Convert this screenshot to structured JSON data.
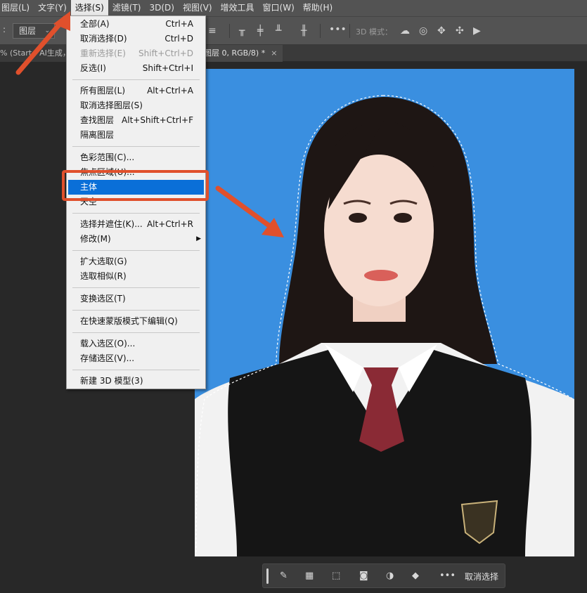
{
  "menubar": {
    "items": [
      "图层(L)",
      "文字(Y)",
      "选择(S)",
      "滤镜(T)",
      "3D(D)",
      "视图(V)",
      "增效工具",
      "窗口(W)",
      "帮助(H)"
    ]
  },
  "options": {
    "layer_dropdown": "图层",
    "label_3d": "3D 模式："
  },
  "tabs": {
    "left": "% (Start，AI生成，",
    "right": "图层 0, RGB/8) *",
    "close": "×"
  },
  "select_menu": {
    "groups": [
      [
        {
          "label": "全部(A)",
          "shortcut": "Ctrl+A"
        },
        {
          "label": "取消选择(D)",
          "shortcut": "Ctrl+D"
        },
        {
          "label": "重新选择(E)",
          "shortcut": "Shift+Ctrl+D",
          "disabled": true
        },
        {
          "label": "反选(I)",
          "shortcut": "Shift+Ctrl+I"
        }
      ],
      [
        {
          "label": "所有图层(L)",
          "shortcut": "Alt+Ctrl+A"
        },
        {
          "label": "取消选择图层(S)",
          "shortcut": ""
        },
        {
          "label": "查找图层",
          "shortcut": "Alt+Shift+Ctrl+F"
        },
        {
          "label": "隔离图层",
          "shortcut": ""
        }
      ],
      [
        {
          "label": "色彩范围(C)...",
          "shortcut": ""
        },
        {
          "label": "焦点区域(U)...",
          "shortcut": ""
        },
        {
          "label": "主体",
          "shortcut": "",
          "highlighted": true
        },
        {
          "label": "天空",
          "shortcut": ""
        }
      ],
      [
        {
          "label": "选择并遮住(K)...",
          "shortcut": "Alt+Ctrl+R"
        },
        {
          "label": "修改(M)",
          "shortcut": "",
          "submenu": true
        }
      ],
      [
        {
          "label": "扩大选取(G)",
          "shortcut": ""
        },
        {
          "label": "选取相似(R)",
          "shortcut": ""
        }
      ],
      [
        {
          "label": "变换选区(T)",
          "shortcut": ""
        }
      ],
      [
        {
          "label": "在快速蒙版模式下编辑(Q)",
          "shortcut": ""
        }
      ],
      [
        {
          "label": "载入选区(O)...",
          "shortcut": ""
        },
        {
          "label": "存储选区(V)...",
          "shortcut": ""
        }
      ],
      [
        {
          "label": "新建 3D 模型(3)",
          "shortcut": ""
        }
      ]
    ]
  },
  "context_bar": {
    "deselect_label": "取消选择"
  },
  "colors": {
    "annotation": "#e0502c",
    "highlight": "#0a6fd8",
    "photo_background": "#3a8fe0"
  }
}
